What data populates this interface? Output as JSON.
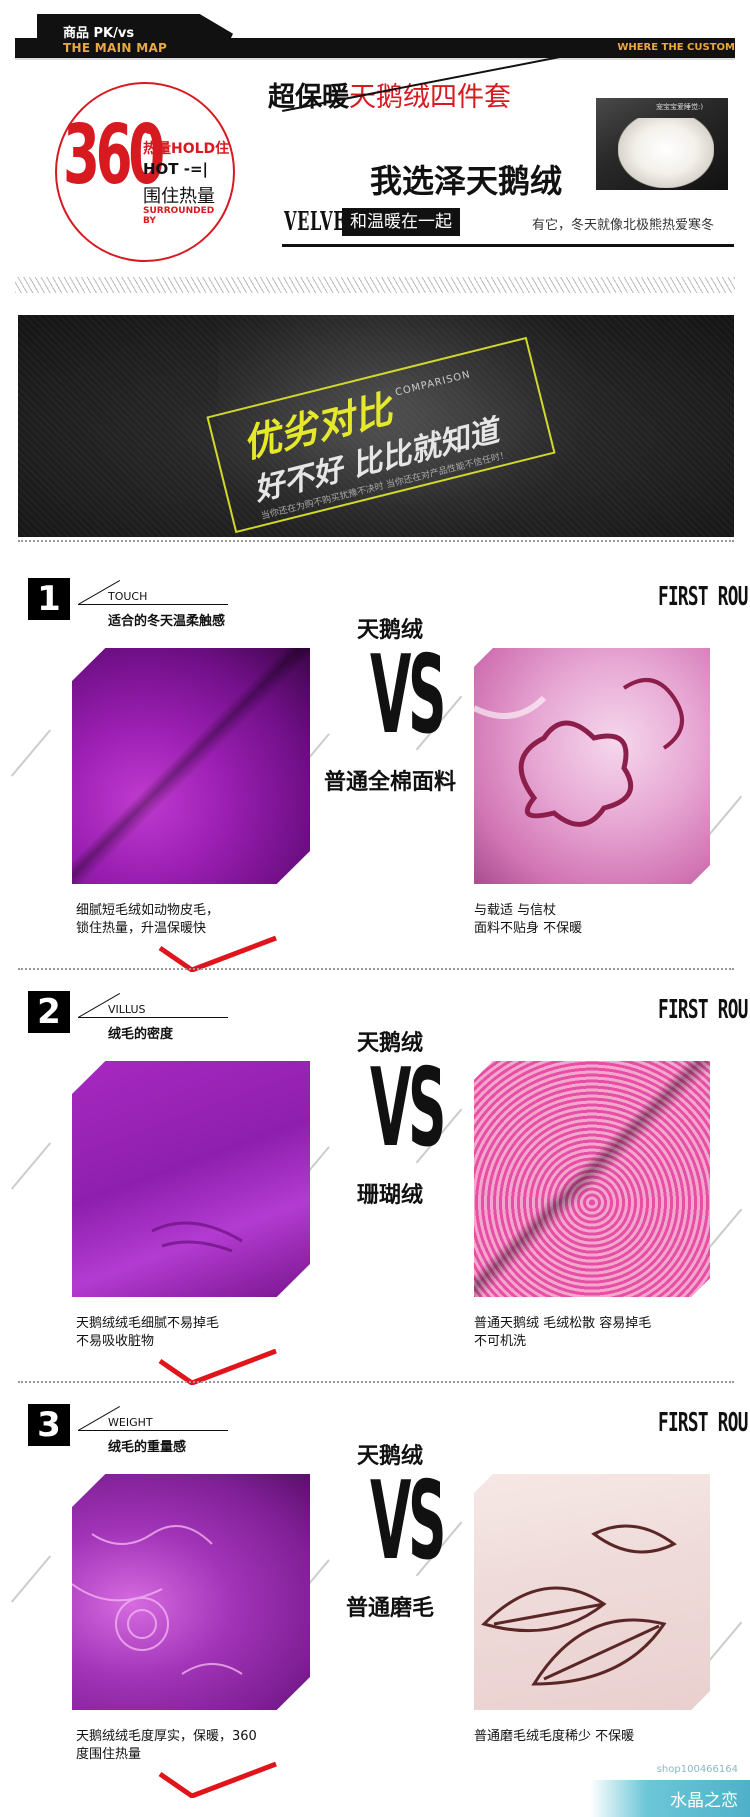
{
  "header": {
    "nav_cn": "商品 PK/vs",
    "nav_en": "THE MAIN MAP",
    "right_tag": "WHERE THE CUSTOM"
  },
  "badge": {
    "number": "360",
    "hold": "热量HOLD住",
    "hot": "HOT -=|",
    "wrap": "围住热量",
    "surround": "SURROUNDED BY"
  },
  "title": {
    "prefix": "超保暖",
    "product": "天鹅绒四件套",
    "slogan": "我选泽天鹅绒",
    "photo_tag": "宠宝宝爱睡觉:)",
    "velvet": "VELVET",
    "warm_label": "和温暖在一起",
    "warm_text": "有它，冬天就像北极熊热爱寒冬"
  },
  "banner": {
    "yellow": "优劣对比",
    "comparison": "COMPARISON",
    "white": "好不好 比比就知道",
    "small": "当你还在为购不购买犹豫不决时 当你还在对产品性能不信任时！"
  },
  "sections": [
    {
      "num": "1",
      "kw": "TOUCH",
      "sub": "适合的冬天温柔触感",
      "round": "FIRST ROU",
      "top": "天鹅绒",
      "vs": "VS",
      "bottom": "普通全棉面料",
      "left_caption": [
        "细腻短毛绒如动物皮毛，",
        "锁住热量，升温保暖快"
      ],
      "right_caption": [
        "与载适 与信杖",
        "面料不贴身 不保暖"
      ]
    },
    {
      "num": "2",
      "kw": "VILLUS",
      "sub": "绒毛的密度",
      "round": "FIRST ROU",
      "top": "天鹅绒",
      "vs": "VS",
      "bottom": "珊瑚绒",
      "left_caption": [
        "天鹅绒绒毛细腻不易掉毛",
        "不易吸收脏物"
      ],
      "right_caption": [
        "普通天鹅绒 毛绒松散 容易掉毛",
        "不可机洗"
      ]
    },
    {
      "num": "3",
      "kw": "WEIGHT",
      "sub": "绒毛的重量感",
      "round": "FIRST ROU",
      "top": "天鹅绒",
      "vs": "VS",
      "bottom": "普通磨毛",
      "left_caption": [
        "天鹅绒绒毛度厚实，保暖，360",
        "度围住热量"
      ],
      "right_caption": [
        "普通磨毛绒毛度稀少 不保暖",
        ""
      ]
    }
  ],
  "watermark": {
    "shop": "shop100466164",
    "name": "水晶之恋"
  },
  "colors": {
    "accent_red": "#d71920",
    "gold": "#e7a940",
    "banner_yellow": "#e6e82c"
  }
}
